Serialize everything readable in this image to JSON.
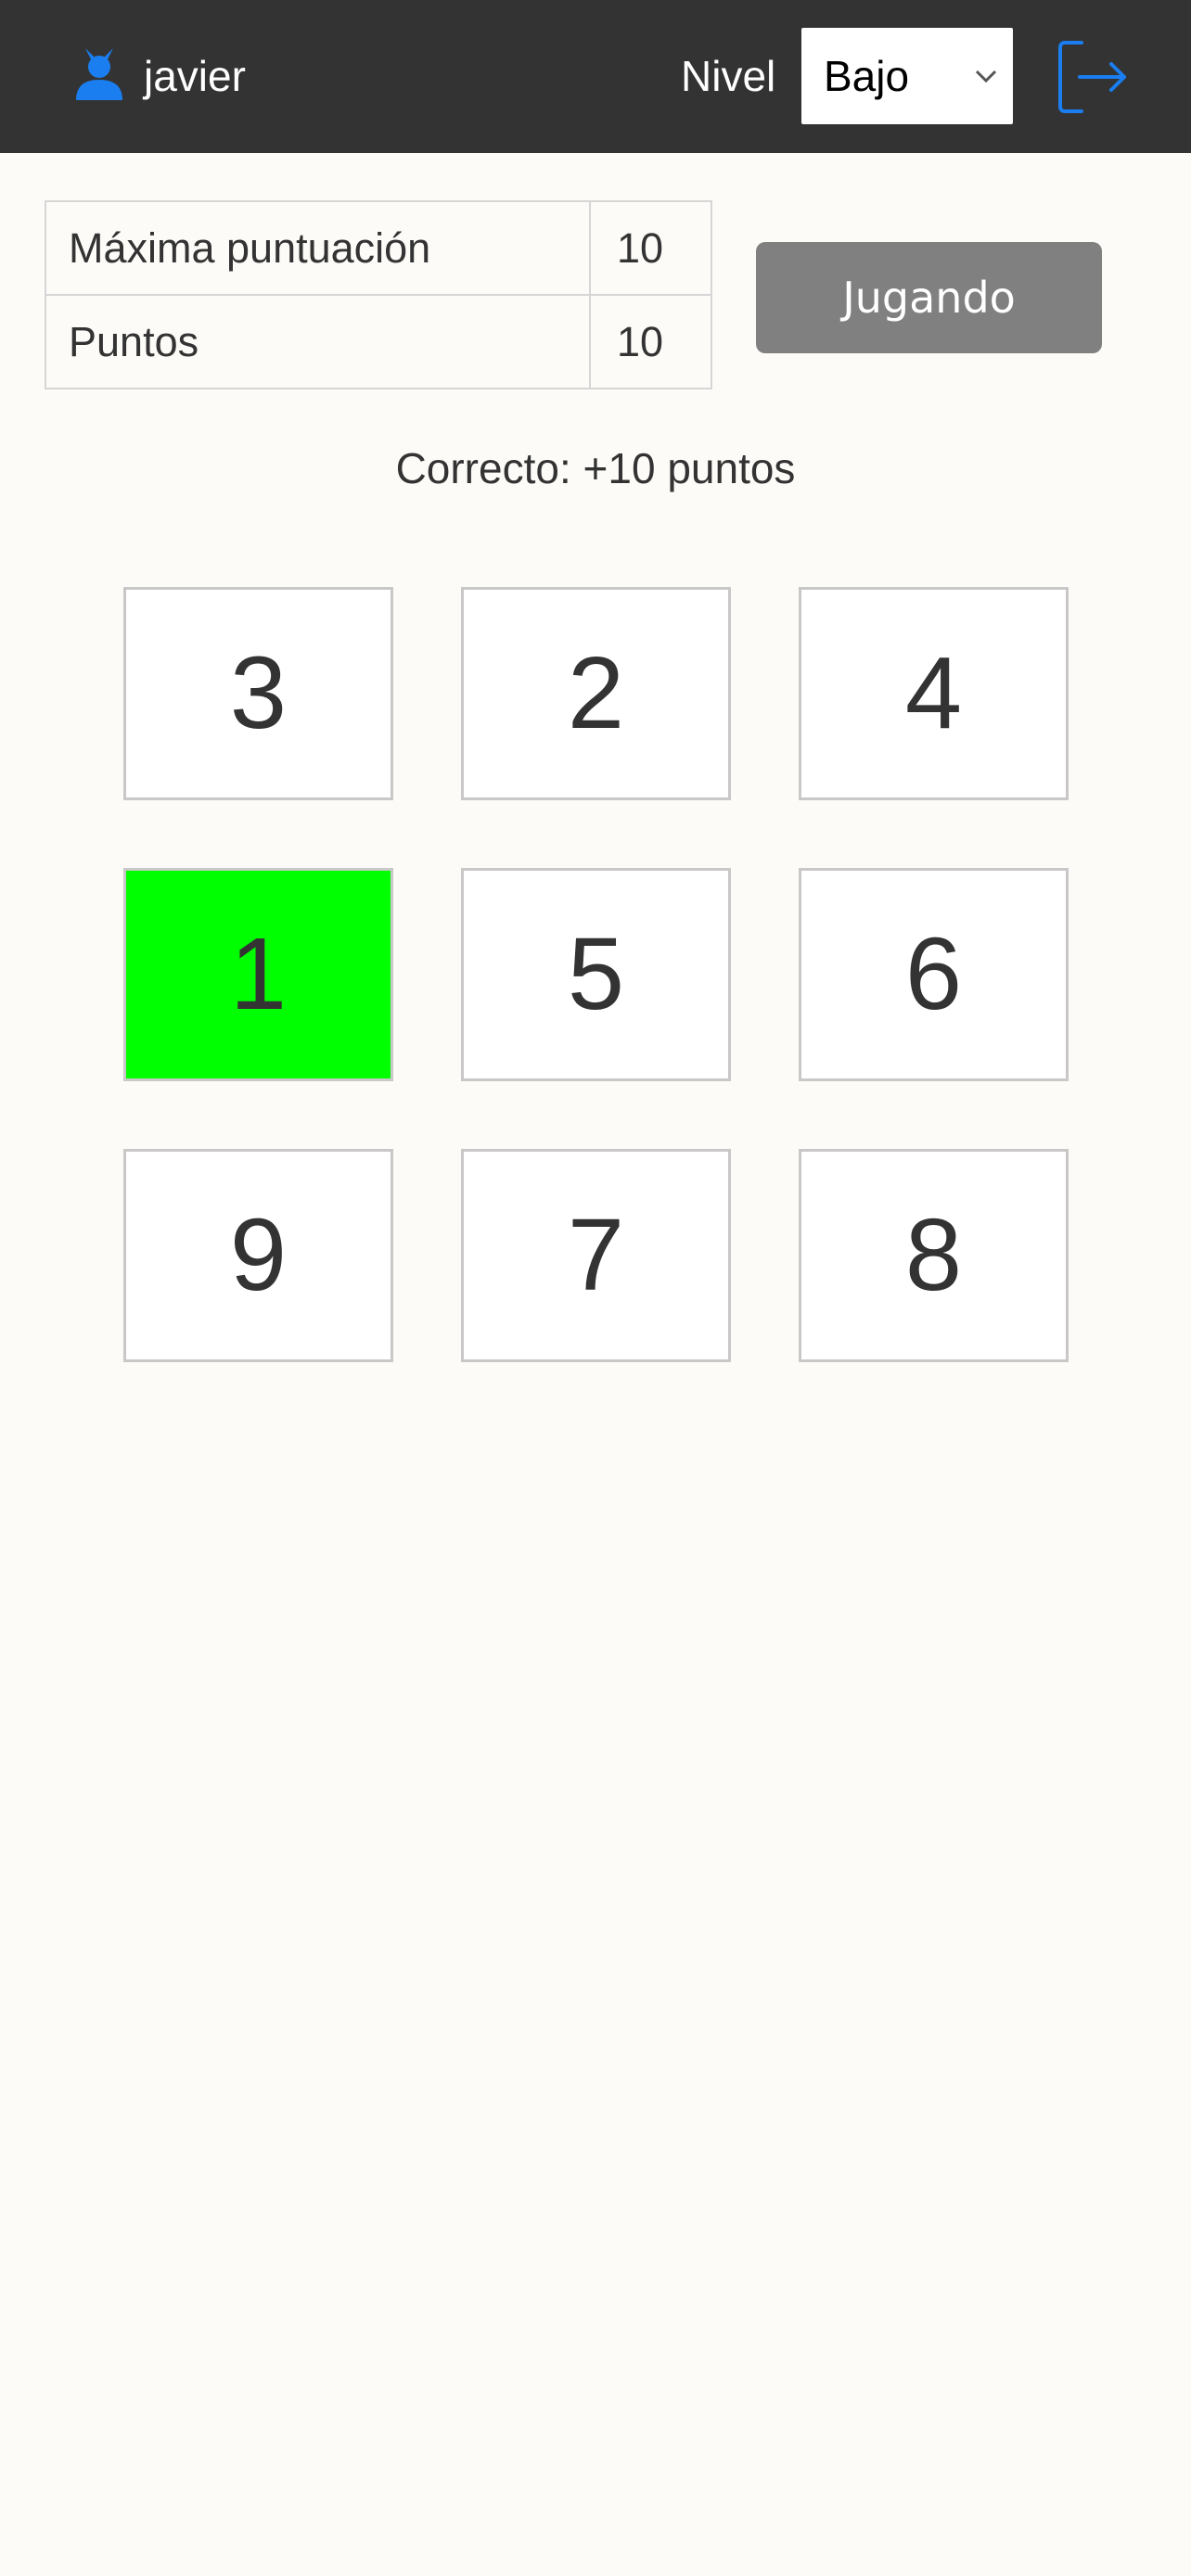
{
  "header": {
    "username": "javier",
    "level_label": "Nivel",
    "level_selected": "Bajo",
    "user_icon": "user-avatar-icon",
    "chevron_icon": "chevron-down-icon",
    "logout_icon": "logout-icon",
    "background_color": "#333333",
    "accent_color": "#1a7ef0"
  },
  "scores": {
    "rows": [
      {
        "label": "Máxima puntuación",
        "value": "10"
      },
      {
        "label": "Puntos",
        "value": "10"
      }
    ]
  },
  "play_button": {
    "label": "Jugando",
    "color": "#808080"
  },
  "status_message": "Correcto: +10 puntos",
  "grid": {
    "tiles": [
      "3",
      "2",
      "4",
      "1",
      "5",
      "6",
      "9",
      "7",
      "8"
    ],
    "highlighted_tile": "1",
    "highlight_color": "#00ff00"
  }
}
